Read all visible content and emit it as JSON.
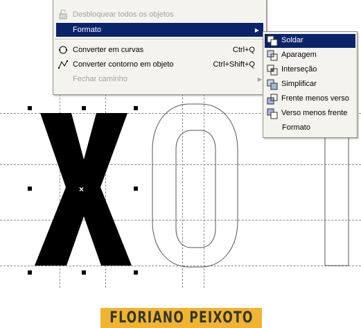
{
  "main_menu": {
    "items": [
      {
        "label": "Desbloquear todos os objetos",
        "enabled": false,
        "icon": "unlock-objects-icon"
      },
      {
        "label": "Formato",
        "enabled": true,
        "highlighted": true,
        "has_submenu": true
      },
      {
        "label": "Converter em curvas",
        "shortcut": "Ctrl+Q",
        "enabled": true,
        "icon": "convert-curves-icon"
      },
      {
        "label": "Converter contorno em objeto",
        "shortcut": "Ctrl+Shift+Q",
        "enabled": true,
        "icon": "convert-outline-icon"
      },
      {
        "label": "Fechar caminho",
        "enabled": false,
        "has_submenu": true
      }
    ]
  },
  "submenu_formato": {
    "items": [
      {
        "label": "Soldar",
        "icon": "weld-icon",
        "highlighted": true
      },
      {
        "label": "Aparagem",
        "icon": "trim-icon"
      },
      {
        "label": "Interseção",
        "icon": "intersect-icon"
      },
      {
        "label": "Simplificar",
        "icon": "simplify-icon"
      },
      {
        "label": "Frente menos verso",
        "icon": "front-minus-back-icon"
      },
      {
        "label": "Verso menos frente",
        "icon": "back-minus-front-icon"
      },
      {
        "label": "Formato",
        "icon": null
      }
    ]
  },
  "canvas": {
    "glyphs": [
      "X",
      "O",
      "I"
    ],
    "selection_center": "×"
  },
  "banner": {
    "text": "FLORIANO PEIXOTO",
    "background": "#f0b431",
    "text_color": "#35362f"
  },
  "colors": {
    "menu_background": "#f4f3ee",
    "menu_highlight": "#0a246a",
    "disabled_text": "#a3a29c"
  }
}
